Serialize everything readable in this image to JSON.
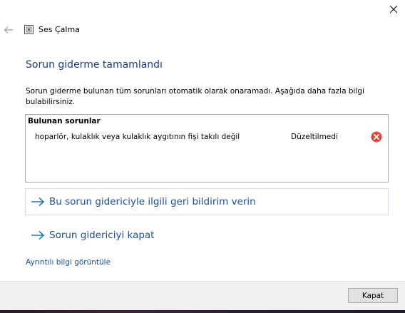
{
  "window": {
    "title": "Ses Çalma"
  },
  "heading": "Sorun giderme tamamlandı",
  "description": "Sorun giderme bulunan tüm sorunları otomatik olarak onaramadı. Aşağıda daha fazla bilgi bulabilirsiniz.",
  "issues": {
    "header": "Bulunan sorunlar",
    "items": [
      {
        "description": "hoparlör, kulaklık veya kulaklık aygıtının fişi takılı değil",
        "status": "Düzeltilmedi",
        "icon": "error-icon"
      }
    ]
  },
  "links": {
    "feedback": "Bu sorun gidericiyle ilgili geri bildirim verin",
    "close_troubleshooter": "Sorun gidericiyi kapat",
    "details": "Ayrıntılı bilgi görüntüle"
  },
  "footer": {
    "close_button": "Kapat"
  },
  "colors": {
    "heading": "#1c3e8a",
    "link": "#1f4e95",
    "arrow": "#2277c8",
    "error": "#e0463a"
  }
}
